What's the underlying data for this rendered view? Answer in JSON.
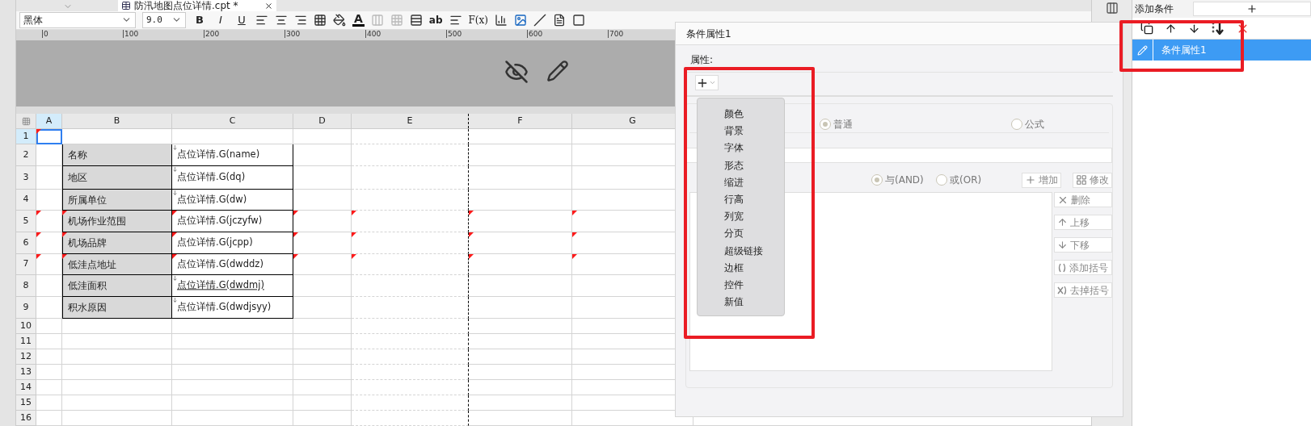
{
  "tab": {
    "title": "防汛地图点位详情.cpt *"
  },
  "toolbar": {
    "font": "黑体",
    "size": "9.0",
    "style_buttons": [
      "B",
      "I",
      "U"
    ],
    "font_color_label": "A",
    "text_tools": [
      "ab",
      "F(x)"
    ]
  },
  "ruler": {
    "ticks": [
      "0",
      "100",
      "200",
      "300",
      "400",
      "500",
      "600",
      "700"
    ]
  },
  "sheet": {
    "columns": [
      {
        "label": "A",
        "selected": true
      },
      {
        "label": "B",
        "selected": false
      },
      {
        "label": "C",
        "selected": false
      },
      {
        "label": "D",
        "selected": false
      },
      {
        "label": "E",
        "selected": false
      },
      {
        "label": "F",
        "selected": false
      },
      {
        "label": "G",
        "selected": false
      }
    ],
    "rows": [
      {
        "label": "1",
        "selected": true,
        "cells": [
          {
            "kind": "blank",
            "flagged": true
          },
          {
            "kind": "blank",
            "flagged": false
          },
          {
            "kind": "blank",
            "flagged": false
          },
          {
            "kind": "blank",
            "flagged": false
          },
          {
            "kind": "blank",
            "flagged": false
          },
          {
            "kind": "blank",
            "flagged": false
          },
          {
            "kind": "blank",
            "flagged": false
          }
        ]
      },
      {
        "label": "2",
        "selected": false,
        "cells": [
          {
            "kind": "blank",
            "flagged": false
          },
          {
            "kind": "label",
            "text": "名称",
            "flagged": false
          },
          {
            "kind": "field",
            "text": "点位详情.G(name)",
            "underlined": false,
            "flagged": false
          },
          {
            "kind": "blank",
            "flagged": false
          },
          {
            "kind": "blank",
            "flagged": false
          },
          {
            "kind": "blank",
            "flagged": false
          },
          {
            "kind": "blank",
            "flagged": false
          }
        ]
      },
      {
        "label": "3",
        "selected": false,
        "cells": [
          {
            "kind": "blank",
            "flagged": false
          },
          {
            "kind": "label",
            "text": "地区",
            "flagged": false
          },
          {
            "kind": "field",
            "text": "点位详情.G(dq)",
            "underlined": false,
            "flagged": false
          },
          {
            "kind": "blank",
            "flagged": false
          },
          {
            "kind": "blank",
            "flagged": false
          },
          {
            "kind": "blank",
            "flagged": false
          },
          {
            "kind": "blank",
            "flagged": false
          }
        ]
      },
      {
        "label": "4",
        "selected": false,
        "cells": [
          {
            "kind": "blank",
            "flagged": false
          },
          {
            "kind": "label",
            "text": "所属单位",
            "flagged": false
          },
          {
            "kind": "field",
            "text": "点位详情.G(dw)",
            "underlined": false,
            "flagged": false
          },
          {
            "kind": "blank",
            "flagged": false
          },
          {
            "kind": "blank",
            "flagged": false
          },
          {
            "kind": "blank",
            "flagged": false
          },
          {
            "kind": "blank",
            "flagged": false
          }
        ]
      },
      {
        "label": "5",
        "selected": false,
        "cells": [
          {
            "kind": "blank",
            "flagged": true
          },
          {
            "kind": "label",
            "text": "机场作业范围",
            "flagged": true
          },
          {
            "kind": "field",
            "text": "点位详情.G(jczyfw)",
            "underlined": false,
            "flagged": true
          },
          {
            "kind": "blank",
            "flagged": true
          },
          {
            "kind": "blank",
            "flagged": true
          },
          {
            "kind": "blank",
            "flagged": true
          },
          {
            "kind": "blank",
            "flagged": true
          }
        ]
      },
      {
        "label": "6",
        "selected": false,
        "cells": [
          {
            "kind": "blank",
            "flagged": true
          },
          {
            "kind": "label",
            "text": "机场品牌",
            "flagged": true
          },
          {
            "kind": "field",
            "text": "点位详情.G(jcpp)",
            "underlined": false,
            "flagged": true
          },
          {
            "kind": "blank",
            "flagged": true
          },
          {
            "kind": "blank",
            "flagged": true
          },
          {
            "kind": "blank",
            "flagged": true
          },
          {
            "kind": "blank",
            "flagged": true
          }
        ]
      },
      {
        "label": "7",
        "selected": false,
        "cells": [
          {
            "kind": "blank",
            "flagged": true
          },
          {
            "kind": "label",
            "text": "低洼点地址",
            "flagged": true
          },
          {
            "kind": "field",
            "text": "点位详情.G(dwddz)",
            "underlined": false,
            "flagged": true
          },
          {
            "kind": "blank",
            "flagged": true
          },
          {
            "kind": "blank",
            "flagged": true
          },
          {
            "kind": "blank",
            "flagged": true
          },
          {
            "kind": "blank",
            "flagged": true
          }
        ]
      },
      {
        "label": "8",
        "selected": false,
        "cells": [
          {
            "kind": "blank",
            "flagged": false
          },
          {
            "kind": "label",
            "text": "低洼面积",
            "flagged": false
          },
          {
            "kind": "field",
            "text": "点位详情.G(dwdmj)",
            "underlined": true,
            "flagged": false
          },
          {
            "kind": "blank",
            "flagged": false
          },
          {
            "kind": "blank",
            "flagged": false
          },
          {
            "kind": "blank",
            "flagged": false
          },
          {
            "kind": "blank",
            "flagged": false
          }
        ]
      },
      {
        "label": "9",
        "selected": false,
        "cells": [
          {
            "kind": "blank",
            "flagged": false
          },
          {
            "kind": "label",
            "text": "积水原因",
            "flagged": false
          },
          {
            "kind": "field",
            "text": "点位详情.G(dwdjsyy)",
            "underlined": false,
            "flagged": false
          },
          {
            "kind": "blank",
            "flagged": false
          },
          {
            "kind": "blank",
            "flagged": false
          },
          {
            "kind": "blank",
            "flagged": false
          },
          {
            "kind": "blank",
            "flagged": false
          }
        ]
      },
      {
        "label": "10",
        "selected": false
      },
      {
        "label": "11",
        "selected": false
      },
      {
        "label": "12",
        "selected": false
      },
      {
        "label": "13",
        "selected": false
      },
      {
        "label": "14",
        "selected": false
      },
      {
        "label": "15",
        "selected": false
      },
      {
        "label": "16",
        "selected": false
      }
    ]
  },
  "dialog": {
    "title": "条件属性1",
    "property_label": "属性:",
    "type_options": [
      {
        "label": "普通",
        "selected": true
      },
      {
        "label": "公式",
        "selected": false
      }
    ],
    "logic_options": [
      {
        "label": "与(AND)",
        "selected": true
      },
      {
        "label": "或(OR)",
        "selected": false
      }
    ],
    "actions": [
      {
        "label": "增加",
        "kind": "add"
      },
      {
        "label": "修改",
        "kind": "edit"
      }
    ],
    "side_buttons": [
      {
        "label": "删除",
        "kind": "delete"
      },
      {
        "label": "上移",
        "kind": "up"
      },
      {
        "label": "下移",
        "kind": "down"
      },
      {
        "label": "添加括号",
        "kind": "bracket"
      },
      {
        "label": "去掉括号",
        "kind": "unbracket"
      }
    ]
  },
  "menu": {
    "items": [
      "颜色",
      "背景",
      "字体",
      "形态",
      "缩进",
      "行高",
      "列宽",
      "分页",
      "超级链接",
      "边框",
      "控件",
      "新值"
    ]
  },
  "right_panel": {
    "add_label": "添加条件",
    "conditions": [
      {
        "label": "条件属性1",
        "selected": true
      }
    ]
  }
}
